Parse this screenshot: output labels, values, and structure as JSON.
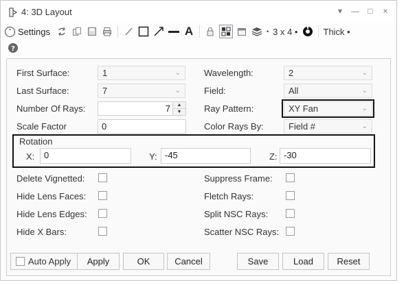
{
  "window": {
    "title": "4: 3D Layout",
    "controls": [
      "▾",
      "—",
      "□",
      "×"
    ]
  },
  "toolbar": {
    "settings_label": "Settings",
    "layout_label": "3 x 4 •",
    "thickness_label": "Thick •",
    "icons": [
      "refresh-icon",
      "copy-icon",
      "save-icon",
      "print-icon",
      "pencil-icon",
      "rectangle-icon",
      "arrow-icon",
      "line-icon",
      "text-icon",
      "lock-icon",
      "grid-icon",
      "window-icon",
      "layers-icon",
      "dropdown-icon",
      "wiki-icon",
      "help-icon"
    ]
  },
  "settings": {
    "first_surface": {
      "label": "First Surface:",
      "value": "1"
    },
    "last_surface": {
      "label": "Last Surface:",
      "value": "7"
    },
    "number_of_rays": {
      "label": "Number Of Rays:",
      "value": "7"
    },
    "scale_factor": {
      "label": "Scale Factor",
      "value": "0"
    },
    "wavelength": {
      "label": "Wavelength:",
      "value": "2"
    },
    "field": {
      "label": "Field:",
      "value": "All"
    },
    "ray_pattern": {
      "label": "Ray Pattern:",
      "value": "XY Fan"
    },
    "color_rays_by": {
      "label": "Color Rays By:",
      "value": "Field #"
    },
    "rotation": {
      "label": "Rotation",
      "x_label": "X:",
      "x_value": "0",
      "y_label": "Y:",
      "y_value": "-45",
      "z_label": "Z:",
      "z_value": "-30"
    },
    "checkboxes_left": [
      {
        "label": "Delete Vignetted:",
        "checked": false
      },
      {
        "label": "Hide Lens Faces:",
        "checked": false
      },
      {
        "label": "Hide Lens Edges:",
        "checked": false
      },
      {
        "label": "Hide X Bars:",
        "checked": false
      }
    ],
    "checkboxes_right": [
      {
        "label": "Suppress Frame:",
        "checked": false
      },
      {
        "label": "Fletch Rays:",
        "checked": false
      },
      {
        "label": "Split NSC Rays:",
        "checked": false
      },
      {
        "label": "Scatter NSC Rays:",
        "checked": false
      }
    ]
  },
  "footer": {
    "auto_apply_label": "Auto Apply",
    "apply_label": "Apply",
    "ok_label": "OK",
    "cancel_label": "Cancel",
    "save_label": "Save",
    "load_label": "Load",
    "reset_label": "Reset"
  }
}
